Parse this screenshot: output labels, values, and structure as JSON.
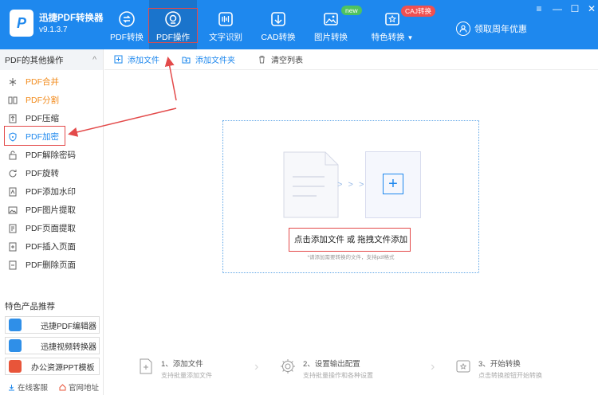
{
  "app": {
    "name": "迅捷PDF转换器",
    "version": "v9.1.3.7",
    "logo_letter": "P"
  },
  "nav": [
    {
      "label": "PDF转换",
      "icon": "convert-icon"
    },
    {
      "label": "PDF操作",
      "icon": "pdf-ops-icon",
      "active": true
    },
    {
      "label": "文字识别",
      "icon": "ocr-icon"
    },
    {
      "label": "CAD转换",
      "icon": "cad-icon"
    },
    {
      "label": "图片转换",
      "icon": "image-icon",
      "badge": "new"
    },
    {
      "label": "特色转换",
      "icon": "special-icon",
      "badge": "CAJ转换",
      "dropdown": "▼"
    }
  ],
  "promo": "领取周年优惠",
  "window_controls": [
    "≡",
    "—",
    "☐",
    "✕"
  ],
  "sidebar": {
    "title": "PDF的其他操作",
    "collapse_icon": "^",
    "items": [
      {
        "label": "PDF合并",
        "style": "orange"
      },
      {
        "label": "PDF分割",
        "style": "orange"
      },
      {
        "label": "PDF压缩",
        "style": "normal"
      },
      {
        "label": "PDF加密",
        "style": "selected"
      },
      {
        "label": "PDF解除密码",
        "style": "normal"
      },
      {
        "label": "PDF旋转",
        "style": "normal"
      },
      {
        "label": "PDF添加水印",
        "style": "normal"
      },
      {
        "label": "PDF图片提取",
        "style": "normal"
      },
      {
        "label": "PDF页面提取",
        "style": "normal"
      },
      {
        "label": "PDF插入页面",
        "style": "normal"
      },
      {
        "label": "PDF删除页面",
        "style": "normal"
      }
    ],
    "products_title": "特色产品推荐",
    "products": [
      {
        "label": "迅捷PDF编辑器",
        "color": "#2f8fe8"
      },
      {
        "label": "迅捷视频转换器",
        "color": "#2f8fe8"
      },
      {
        "label": "办公资源PPT模板",
        "color": "#e8553a"
      }
    ],
    "footer": {
      "service": "在线客服",
      "website": "官网地址"
    }
  },
  "toolbar": {
    "add_file": "添加文件",
    "add_folder": "添加文件夹",
    "clear": "清空列表"
  },
  "dropzone": {
    "main_text": "点击添加文件 或 拖拽文件添加",
    "sub_text": "*请添加需要转换的文件，支持pdf格式",
    "chevrons": "> > >",
    "plus": "+"
  },
  "steps": [
    {
      "title": "1、添加文件",
      "desc": "支持批量添加文件"
    },
    {
      "title": "2、设置输出配置",
      "desc": "支持批量操作和各种设置"
    },
    {
      "title": "3、开始转换",
      "desc": "点击转换按钮开始转换"
    }
  ],
  "step_separator": "›",
  "colors": {
    "brand": "#1e88ee",
    "highlight": "#e34a4a",
    "orange": "#f28a1a"
  }
}
